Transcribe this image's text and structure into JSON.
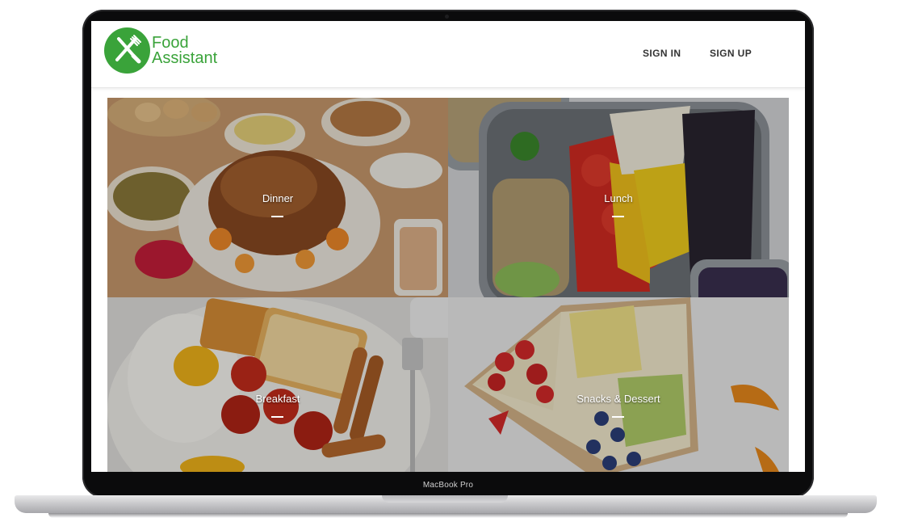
{
  "app": {
    "name_line1": "Food",
    "name_line2": "Assistant",
    "logo_icon": "fork-knife-icon",
    "brand_color": "#3aa33a"
  },
  "nav": {
    "sign_in": "SIGN IN",
    "sign_up": "SIGN UP"
  },
  "categories": [
    {
      "label": "Dinner",
      "image": "roast-turkey-dinner-photo"
    },
    {
      "label": "Lunch",
      "image": "bento-bowl-lunch-photo"
    },
    {
      "label": "Breakfast",
      "image": "eggs-toast-sausage-photo"
    },
    {
      "label": "Snacks & Dessert",
      "image": "fruit-tart-photo"
    }
  ],
  "device": {
    "label": "MacBook Pro"
  }
}
